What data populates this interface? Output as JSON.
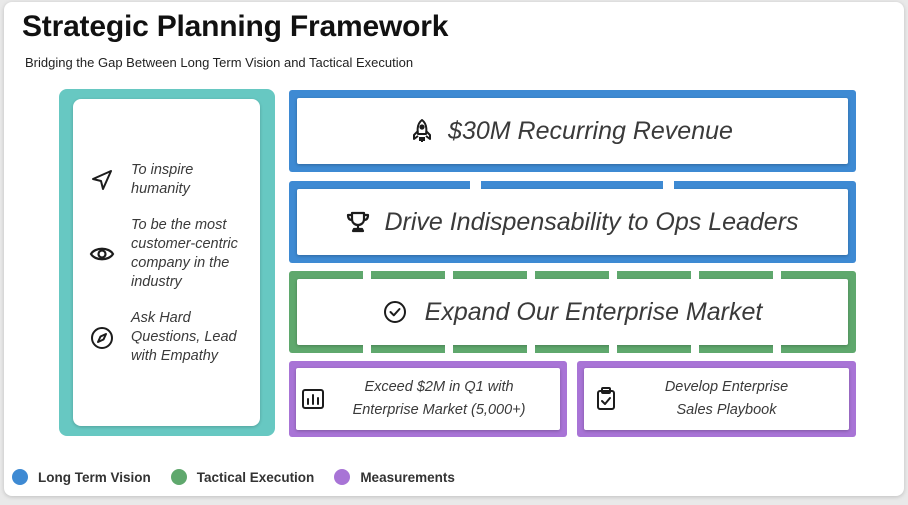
{
  "header": {
    "title": "Strategic Planning Framework",
    "subtitle": "Bridging the Gap Between Long Term Vision and Tactical Execution"
  },
  "mission": {
    "items": [
      {
        "icon": "send-icon",
        "text": "To inspire humanity"
      },
      {
        "icon": "eye-icon",
        "text": "To be the most customer-centric company in the industry"
      },
      {
        "icon": "compass-icon",
        "text": "Ask Hard Questions, Lead with Empathy"
      }
    ]
  },
  "goals": {
    "revenue": {
      "icon": "rocket-icon",
      "text": "$30M Recurring Revenue"
    },
    "indispensability": {
      "icon": "trophy-icon",
      "text": "Drive Indispensability to Ops Leaders"
    },
    "enterprise": {
      "icon": "check-circle-icon",
      "text": "Expand Our Enterprise Market"
    }
  },
  "measurements": [
    {
      "icon": "bar-chart-icon",
      "line1": "Exceed $2M in Q1 with",
      "line2": "Enterprise Market (5,000+)"
    },
    {
      "icon": "clipboard-check-icon",
      "line1": "Develop Enterprise",
      "line2": "Sales Playbook"
    }
  ],
  "legend": [
    {
      "label": "Long Term Vision",
      "color": "#3e8ad3"
    },
    {
      "label": "Tactical Execution",
      "color": "#5fa86d"
    },
    {
      "label": "Measurements",
      "color": "#a874d6"
    }
  ],
  "colors": {
    "mission": "#67c8c2",
    "blue": "#3e8ad3",
    "green": "#5fa86d",
    "purple": "#a874d6"
  }
}
